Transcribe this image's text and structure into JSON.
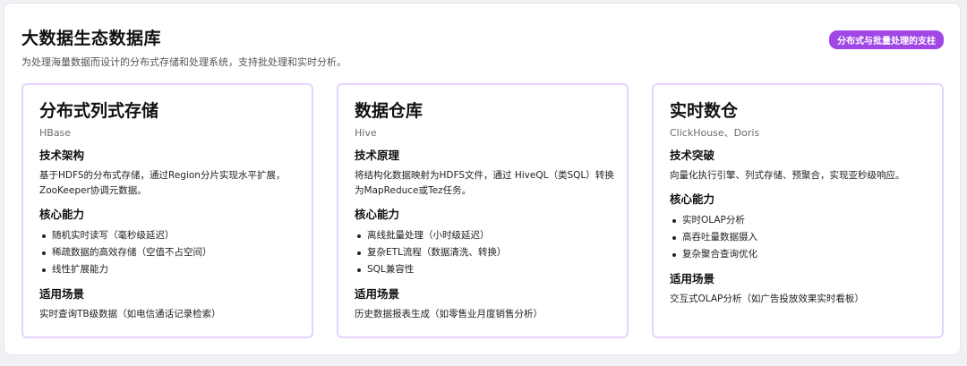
{
  "header": {
    "title": "大数据生态数据库",
    "subtitle": "为处理海量数据而设计的分布式存储和处理系统，支持批处理和实时分析。",
    "badge": "分布式与批量处理的支柱"
  },
  "colors": {
    "accent": "#a147e6",
    "card_border": "#e6d4fb"
  },
  "cards": [
    {
      "title": "分布式列式存储",
      "tech": "HBase",
      "s1_heading": "技术架构",
      "s1_text": "基于HDFS的分布式存储，通过Region分片实现水平扩展，ZooKeeper协调元数据。",
      "s2_heading": "核心能力",
      "capabilities": [
        "随机实时读写（毫秒级延迟）",
        "稀疏数据的高效存储（空值不占空间）",
        "线性扩展能力"
      ],
      "s3_heading": "适用场景",
      "scenario": "实时查询TB级数据（如电信通话记录检索）"
    },
    {
      "title": "数据仓库",
      "tech": "Hive",
      "s1_heading": "技术原理",
      "s1_text": "将结构化数据映射为HDFS文件，通过 HiveQL（类SQL）转换为MapReduce或Tez任务。",
      "s2_heading": "核心能力",
      "capabilities": [
        "离线批量处理（小时级延迟）",
        "复杂ETL流程（数据清洗、转换）",
        "SQL兼容性"
      ],
      "s3_heading": "适用场景",
      "scenario": "历史数据报表生成（如零售业月度销售分析）"
    },
    {
      "title": "实时数仓",
      "tech": "ClickHouse、Doris",
      "s1_heading": "技术突破",
      "s1_text": "向量化执行引擎、列式存储、预聚合，实现亚秒级响应。",
      "s2_heading": "核心能力",
      "capabilities": [
        "实时OLAP分析",
        "高吞吐量数据摄入",
        "复杂聚合查询优化"
      ],
      "s3_heading": "适用场景",
      "scenario": "交互式OLAP分析（如广告投放效果实时看板）"
    }
  ]
}
